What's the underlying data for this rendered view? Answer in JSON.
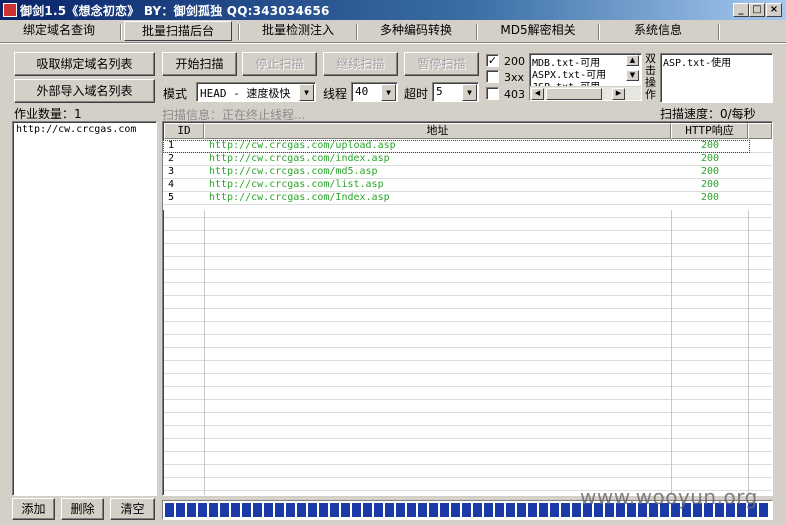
{
  "window": {
    "title": "御剑1.5《想念初恋》  BY：御剑孤独  QQ:343034656",
    "minimize": "_",
    "maximize": "□",
    "close": "×"
  },
  "tabs": [
    "绑定域名查询",
    "批量扫描后台",
    "批量检测注入",
    "多种编码转换",
    "MD5解密相关",
    "系统信息"
  ],
  "active_tab": 1,
  "left": {
    "fetch_button": "吸取绑定域名列表",
    "import_button": "外部导入域名列表",
    "job_count_label": "作业数量：1",
    "domains": [
      "http://cw.crcgas.com"
    ],
    "add_button": "添加",
    "delete_button": "删除",
    "clear_button": "清空"
  },
  "toolbar": {
    "start": "开始扫描",
    "stop": "停止扫描",
    "resume": "继续扫描",
    "pause": "暂停扫描",
    "mode_label": "模式",
    "mode_value": "HEAD - 速度极快",
    "threads_label": "线程",
    "threads_value": "40",
    "timeout_label": "超时",
    "timeout_value": "5"
  },
  "status_filters": [
    {
      "label": "200",
      "checked": true
    },
    {
      "label": "3xx",
      "checked": false
    },
    {
      "label": "403",
      "checked": false
    }
  ],
  "check_mark": "✓",
  "dict_list": [
    "MDB.txt-可用",
    "ASPX.txt-可用",
    "JSP.txt-可用"
  ],
  "dblclick_label": [
    "双",
    "击",
    "操",
    "作"
  ],
  "selected_dicts": [
    "ASP.txt-使用"
  ],
  "scan_info": "扫描信息：正在终止线程...",
  "scan_speed": "扫描速度：0/每秒",
  "table": {
    "columns": [
      "ID",
      "地址",
      "HTTP响应"
    ],
    "rows": [
      {
        "id": "1",
        "url": "http://cw.crcgas.com/upload.asp",
        "code": "200"
      },
      {
        "id": "2",
        "url": "http://cw.crcgas.com/index.asp",
        "code": "200"
      },
      {
        "id": "3",
        "url": "http://cw.crcgas.com/md5.asp",
        "code": "200"
      },
      {
        "id": "4",
        "url": "http://cw.crcgas.com/list.asp",
        "code": "200"
      },
      {
        "id": "5",
        "url": "http://cw.crcgas.com/Index.asp",
        "code": "200"
      }
    ]
  },
  "progress": 1.0,
  "watermark": "www.wooyun.org"
}
